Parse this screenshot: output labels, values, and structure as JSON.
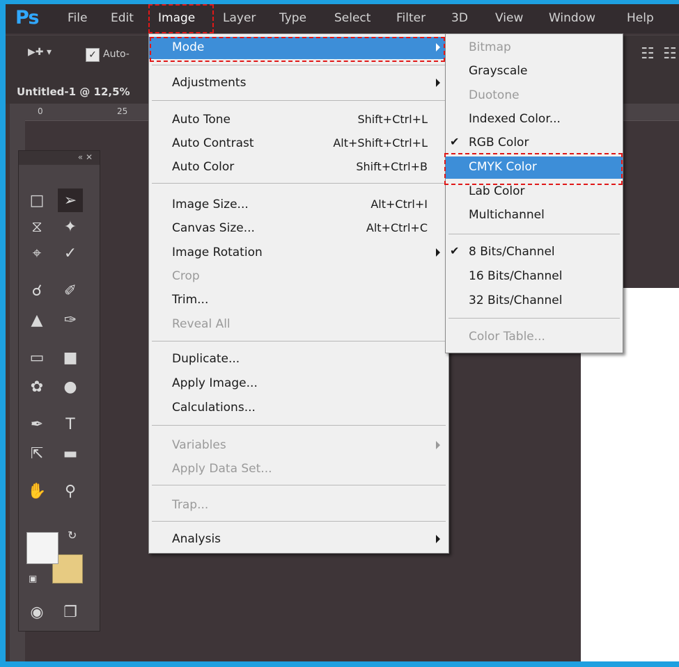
{
  "app": {
    "logo": "Ps"
  },
  "menubar": [
    "File",
    "Edit",
    "Image",
    "Layer",
    "Type",
    "Select",
    "Filter",
    "3D",
    "View",
    "Window",
    "Help"
  ],
  "options": {
    "auto_label": "Auto-"
  },
  "document": {
    "tab_title": "Untitled-1 @ 12,5%",
    "ruler_0": "0",
    "ruler_25": "25"
  },
  "image_menu": {
    "mode": "Mode",
    "adjustments": "Adjustments",
    "auto_tone": "Auto Tone",
    "auto_tone_sc": "Shift+Ctrl+L",
    "auto_contrast": "Auto Contrast",
    "auto_contrast_sc": "Alt+Shift+Ctrl+L",
    "auto_color": "Auto Color",
    "auto_color_sc": "Shift+Ctrl+B",
    "image_size": "Image Size...",
    "image_size_sc": "Alt+Ctrl+I",
    "canvas_size": "Canvas Size...",
    "canvas_size_sc": "Alt+Ctrl+C",
    "image_rotation": "Image Rotation",
    "crop": "Crop",
    "trim": "Trim...",
    "reveal_all": "Reveal All",
    "duplicate": "Duplicate...",
    "apply_image": "Apply Image...",
    "calculations": "Calculations...",
    "variables": "Variables",
    "apply_data_set": "Apply Data Set...",
    "trap": "Trap...",
    "analysis": "Analysis"
  },
  "mode_menu": {
    "bitmap": "Bitmap",
    "grayscale": "Grayscale",
    "duotone": "Duotone",
    "indexed": "Indexed Color...",
    "rgb": "RGB Color",
    "cmyk": "CMYK Color",
    "lab": "Lab Color",
    "multichannel": "Multichannel",
    "bits8": "8 Bits/Channel",
    "bits16": "16 Bits/Channel",
    "bits32": "32 Bits/Channel",
    "color_table": "Color Table..."
  }
}
